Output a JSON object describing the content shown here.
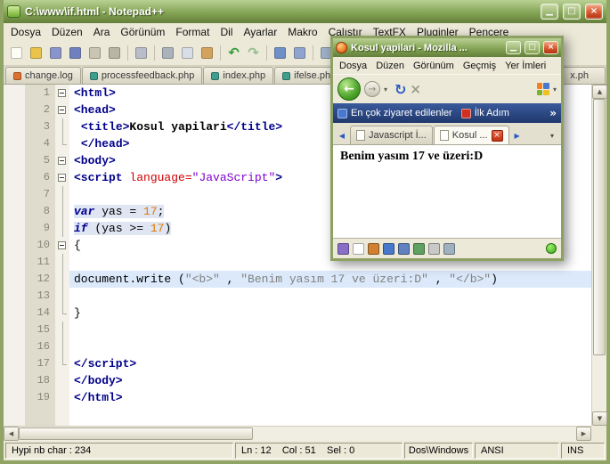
{
  "icons": {
    "minimize": "▁",
    "maximize": "□",
    "close": "×",
    "back": "←",
    "forward": "→",
    "caret_down": "▾",
    "refresh": "↻",
    "stop": "×",
    "scroll_left": "◀",
    "scroll_right": "▶",
    "scroll_up": "▲",
    "scroll_down": "▼",
    "overflow": "»"
  },
  "notepad": {
    "title": "C:\\www\\if.html - Notepad++",
    "menus": [
      "Dosya",
      "Düzen",
      "Ara",
      "Görünüm",
      "Format",
      "Dil",
      "Ayarlar",
      "Makro",
      "Çalıştır",
      "TextFX",
      "Pluginler",
      "Pencere"
    ],
    "toolbar": [
      {
        "name": "new-file",
        "color": "#fdfdf6"
      },
      {
        "name": "open-folder",
        "color": "#e9c34a"
      },
      {
        "name": "save",
        "color": "#8a94cc"
      },
      {
        "name": "save-all",
        "color": "#6f7fc0"
      },
      {
        "name": "close-file",
        "color": "#c9c5b5"
      },
      {
        "name": "close-all",
        "color": "#b9b5a5"
      },
      "|",
      {
        "name": "print",
        "color": "#b9bcc9"
      },
      "|",
      {
        "name": "cut",
        "color": "#aab2bc"
      },
      {
        "name": "copy",
        "color": "#d9dde8"
      },
      {
        "name": "paste",
        "color": "#d2a35c"
      },
      "|",
      {
        "name": "undo",
        "color": "#2f9e39",
        "glyph": "↶"
      },
      {
        "name": "redo",
        "color": "#8fbf8f",
        "glyph": "↷"
      },
      "|",
      {
        "name": "find",
        "color": "#6f8fc9"
      },
      {
        "name": "replace",
        "color": "#8fa3cf"
      },
      "|",
      {
        "name": "zoom-in",
        "color": "#9fb0c9"
      },
      {
        "name": "zoom-out",
        "color": "#b5c2d6"
      },
      "|",
      {
        "name": "word-wrap",
        "color": "#a5b4c4"
      },
      {
        "name": "show-symbols",
        "color": "#c2cbd8"
      }
    ],
    "tabs": [
      {
        "label": "change.log",
        "iconColor": "#e07030"
      },
      {
        "label": "processfeedback.php",
        "iconColor": "#3f9f8f"
      },
      {
        "label": "index.php",
        "iconColor": "#3f9f8f"
      },
      {
        "label": "ifelse.php",
        "iconColor": "#3f9f8f"
      },
      {
        "label": "x.ph",
        "stretch": true
      }
    ],
    "lines": [
      {
        "fold": "minus",
        "tokens": [
          [
            "tag",
            "<html>"
          ]
        ]
      },
      {
        "fold": "minus",
        "tokens": [
          [
            "tag",
            "<head>"
          ]
        ]
      },
      {
        "fold": "vline",
        "tokens": [
          [
            "plain",
            " "
          ],
          [
            "tag",
            "<title>"
          ],
          [
            "boldtext",
            "Kosul yapilari"
          ],
          [
            "tag",
            "</title>"
          ]
        ]
      },
      {
        "fold": "end",
        "tokens": [
          [
            "plain",
            " "
          ],
          [
            "tag",
            "</head>"
          ]
        ]
      },
      {
        "fold": "minus",
        "tokens": [
          [
            "tag",
            "<body>"
          ]
        ]
      },
      {
        "fold": "minus",
        "tokens": [
          [
            "tag",
            "<script "
          ],
          [
            "attr",
            "language="
          ],
          [
            "val",
            "\"JavaScript\""
          ],
          [
            "tag",
            ">"
          ]
        ]
      },
      {
        "fold": "vline",
        "tokens": []
      },
      {
        "fold": "vline",
        "js": true,
        "tokens": [
          [
            "kw",
            "var"
          ],
          [
            "plain",
            " yas = "
          ],
          [
            "num",
            "17"
          ],
          [
            "plain",
            ";"
          ]
        ]
      },
      {
        "fold": "vline",
        "js": true,
        "tokens": [
          [
            "kw",
            "if"
          ],
          [
            "plain",
            " (yas >= "
          ],
          [
            "num",
            "17"
          ],
          [
            "plain",
            ")"
          ]
        ]
      },
      {
        "fold": "minus",
        "tokens": [
          [
            "plain",
            "{"
          ]
        ]
      },
      {
        "fold": "vline",
        "tokens": []
      },
      {
        "fold": "vline",
        "current": true,
        "tokens": [
          [
            "plain",
            "document.write ("
          ],
          [
            "str",
            "\"<b>\""
          ],
          [
            "plain",
            " , "
          ],
          [
            "str",
            "\"Benim yasım 17 ve üzeri:D\""
          ],
          [
            "plain",
            " , "
          ],
          [
            "str",
            "\"</b>\""
          ],
          [
            "plain",
            ")"
          ]
        ]
      },
      {
        "fold": "vline",
        "tokens": []
      },
      {
        "fold": "end",
        "tokens": [
          [
            "plain",
            "}"
          ]
        ]
      },
      {
        "fold": "vline",
        "tokens": []
      },
      {
        "fold": "vline",
        "tokens": []
      },
      {
        "fold": "end",
        "tokens": [
          [
            "tag",
            "</script>"
          ]
        ]
      },
      {
        "fold": "none",
        "tokens": [
          [
            "tag",
            "</body>"
          ]
        ]
      },
      {
        "fold": "none",
        "tokens": [
          [
            "tag",
            "</html>"
          ]
        ]
      }
    ],
    "status": {
      "left": "Hypi nb char : 234",
      "position": "Ln : 12    Col : 51    Sel : 0",
      "eol": "Dos\\Windows",
      "encoding": "ANSI",
      "mode": "INS"
    }
  },
  "firefox": {
    "title": "Kosul yapilari - Mozilla ...",
    "menus": [
      "Dosya",
      "Düzen",
      "Görünüm",
      "Geçmiş",
      "Yer İmleri"
    ],
    "bookmarks": [
      {
        "label": "En çok ziyaret edilenler",
        "iconColor": "#4878d0"
      },
      {
        "label": "İlk Adım",
        "iconColor": "#d03020"
      }
    ],
    "bookmarks_overflow": "»",
    "tabs": [
      {
        "label": "Javascript İ..."
      },
      {
        "label": "Kosul ...",
        "active": true
      }
    ],
    "content_text": "Benim yasım 17 ve üzeri:D",
    "addon_icons": [
      {
        "name": "web-developer",
        "color": "#8a6fc9"
      },
      {
        "name": "blank-page",
        "color": "#ffffff"
      },
      {
        "name": "edit-pencil",
        "color": "#d08030"
      },
      {
        "name": "globe",
        "color": "#4878c9"
      },
      {
        "name": "save-disk",
        "color": "#6080c0"
      },
      {
        "name": "images",
        "color": "#60a060"
      },
      {
        "name": "script",
        "color": "#c9c9c9"
      },
      {
        "name": "network",
        "color": "#9fb0c0"
      }
    ]
  }
}
